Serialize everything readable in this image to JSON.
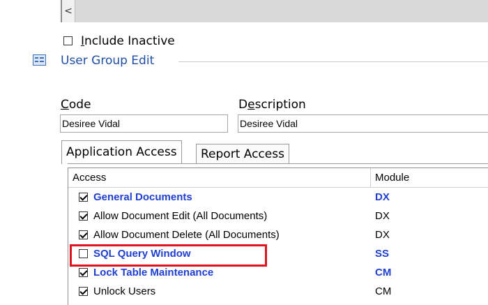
{
  "scrollbar": {
    "left_arrow": "<"
  },
  "include_inactive": {
    "label": "Include Inactive",
    "checked": false
  },
  "group": {
    "title": "User Group Edit",
    "icon": "form-icon"
  },
  "fields": {
    "code_label": "Code",
    "code_value": "Desiree Vidal",
    "description_label": "Description",
    "description_value": "Desiree Vidal"
  },
  "tabs": [
    {
      "label": "Application Access",
      "active": true
    },
    {
      "label": "Report Access",
      "active": false
    }
  ],
  "grid": {
    "columns": [
      "Access",
      "Module"
    ],
    "rows": [
      {
        "access": "General Documents",
        "module": "DX",
        "checked": true,
        "bold": true
      },
      {
        "access": "Allow Document Edit (All Documents)",
        "module": "DX",
        "checked": true,
        "bold": false
      },
      {
        "access": "Allow Document Delete (All Documents)",
        "module": "DX",
        "checked": true,
        "bold": false
      },
      {
        "access": "SQL Query Window",
        "module": "SS",
        "checked": false,
        "bold": true
      },
      {
        "access": "Lock Table Maintenance",
        "module": "CM",
        "checked": true,
        "bold": true
      },
      {
        "access": "Unlock Users",
        "module": "CM",
        "checked": true,
        "bold": false
      }
    ]
  },
  "colors": {
    "accent_blue": "#1f3fd1",
    "title_blue": "#1f4ea8",
    "highlight_red": "#e0141e"
  }
}
